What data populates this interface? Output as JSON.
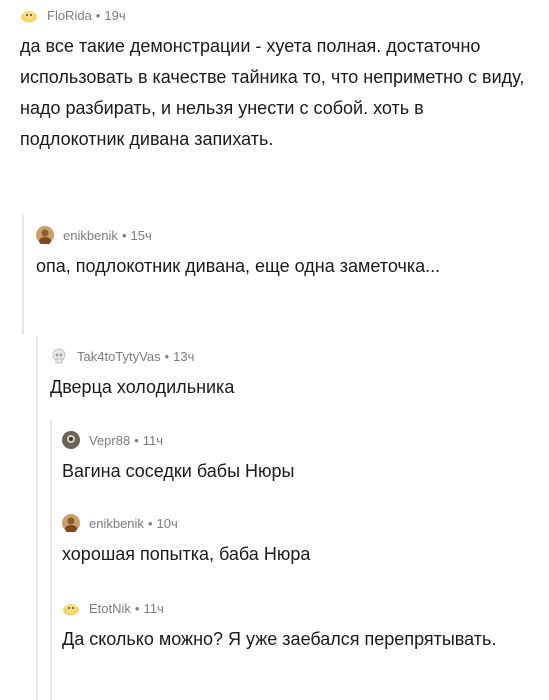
{
  "comments": [
    {
      "author": "FloRida",
      "separator": "•",
      "time": "19ч",
      "avatar_icon": "blob-avatar-icon",
      "avatar_color": "#f5d36b",
      "text": "да все такие демонстрации - хуета полная. достаточно использовать в качестве тайника то, что неприметно с виду, надо разбирать, и нельзя унести с собой. хоть в подлокотник дивана запихать."
    },
    {
      "author": "enikbenik",
      "separator": "•",
      "time": "15ч",
      "avatar_icon": "user-photo-avatar-icon",
      "avatar_color": "#c9a06a",
      "text": "опа, подлокотник дивана, еще одна заметочка..."
    },
    {
      "author": "Tak4toTytyVas",
      "separator": "•",
      "time": "13ч",
      "avatar_icon": "skull-avatar-icon",
      "avatar_color": "#dcdcdc",
      "text": "Дверца холодильника"
    },
    {
      "author": "Vepr88",
      "separator": "•",
      "time": "11ч",
      "avatar_icon": "user-photo-avatar-icon",
      "avatar_color": "#6b6355",
      "text": "Вагина соседки бабы Нюры"
    },
    {
      "author": "enikbenik",
      "separator": "•",
      "time": "10ч",
      "avatar_icon": "user-photo-avatar-icon",
      "avatar_color": "#c9a06a",
      "text": "хорошая попытка, баба Нюра"
    },
    {
      "author": "EtotNik",
      "separator": "•",
      "time": "11ч",
      "avatar_icon": "blob-avatar-icon",
      "avatar_color": "#f5d36b",
      "text": "Да сколько можно? Я уже заебался перепрятывать."
    }
  ]
}
